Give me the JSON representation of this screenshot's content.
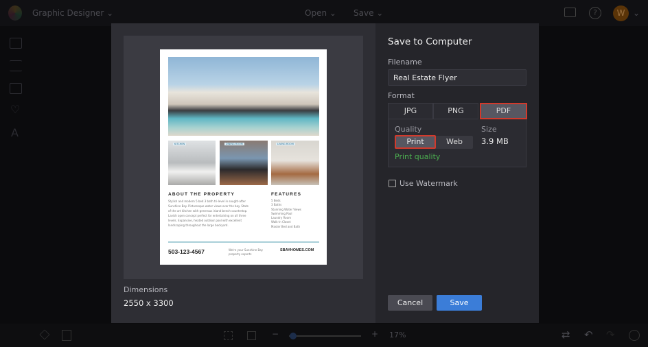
{
  "topbar": {
    "app_name": "Graphic Designer",
    "open_label": "Open",
    "save_label": "Save",
    "avatar_initial": "W"
  },
  "dialog": {
    "title": "Save to Computer",
    "filename_label": "Filename",
    "filename_value": "Real Estate Flyer",
    "format_label": "Format",
    "formats": [
      "JPG",
      "PNG",
      "PDF"
    ],
    "selected_format": "PDF",
    "quality_label": "Quality",
    "qualities": [
      "Print",
      "Web"
    ],
    "selected_quality": "Print",
    "quality_note": "Print quality",
    "size_label": "Size",
    "size_value": "3.9 MB",
    "watermark_label": "Use Watermark",
    "watermark_checked": false,
    "dimensions_label": "Dimensions",
    "dimensions_value": "2550 x 3300",
    "cancel_label": "Cancel",
    "save_label": "Save",
    "accent": "#3b7dd8",
    "highlight": "#d23a2c",
    "note_color": "#4caf50"
  },
  "flyer": {
    "rooms": [
      "KITCHEN",
      "DINING ROOM",
      "LIVING ROOM"
    ],
    "about_title": "ABOUT THE PROPERTY",
    "about_text": "Stylish and modern 5 bed 3 bath tri-level in sought-after Sunshine Bay. Picturesque water views over the bay. State of the art kitchen with generous island bench countertop. Lavish open concept perfect for entertaining on all three levels. Expansive, heated outdoor pool with excellent landscaping throughout the large backyard.",
    "features_title": "FEATURES",
    "features": [
      "5 Beds",
      "3 Baths",
      "Stunning Water Views",
      "Swimming Pool",
      "Laundry Room",
      "Walk-in Closet",
      "Master Bed and Bath"
    ],
    "phone": "503-123-4567",
    "tagline": "We're your Sunshine Bay property experts",
    "website": "SBAYHOMES.COM"
  },
  "bottombar": {
    "zoom": "17%",
    "zoom_fraction": 0.17
  }
}
